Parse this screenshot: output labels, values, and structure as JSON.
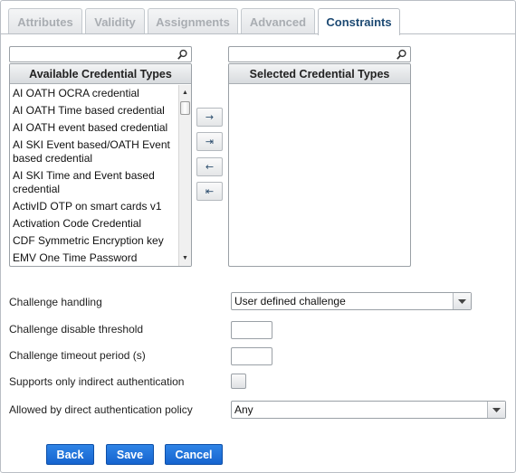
{
  "tabs": [
    {
      "label": "Attributes",
      "active": false
    },
    {
      "label": "Validity",
      "active": false
    },
    {
      "label": "Assignments",
      "active": false
    },
    {
      "label": "Advanced",
      "active": false
    },
    {
      "label": "Constraints",
      "active": true
    }
  ],
  "available": {
    "search_value": "",
    "header": "Available Credential Types",
    "items": [
      "AI OATH OCRA credential",
      "AI OATH Time based credential",
      "AI OATH event based credential",
      "AI SKI Event based/OATH Event based credential",
      "AI SKI Time and Event based credential",
      "ActivID OTP on smart cards v1",
      "Activation Code Credential",
      "CDF Symmetric Encryption key",
      "EMV One Time Password"
    ]
  },
  "selected": {
    "search_value": "",
    "header": "Selected Credential Types",
    "items": []
  },
  "movers": {
    "add": "→",
    "add_all": "⇥",
    "remove": "←",
    "remove_all": "⇤"
  },
  "form": {
    "challenge_handling": {
      "label": "Challenge handling",
      "value": "User defined challenge"
    },
    "challenge_disable_threshold": {
      "label": "Challenge disable threshold",
      "value": ""
    },
    "challenge_timeout": {
      "label": "Challenge timeout period (s)",
      "value": ""
    },
    "indirect_auth": {
      "label": "Supports only indirect authentication",
      "checked": false
    },
    "direct_auth_policy": {
      "label": "Allowed by direct authentication policy",
      "value": "Any"
    }
  },
  "actions": {
    "back": "Back",
    "save": "Save",
    "cancel": "Cancel"
  },
  "colors": {
    "accent": "#1664cf",
    "active_tab_text": "#1d4a73"
  }
}
